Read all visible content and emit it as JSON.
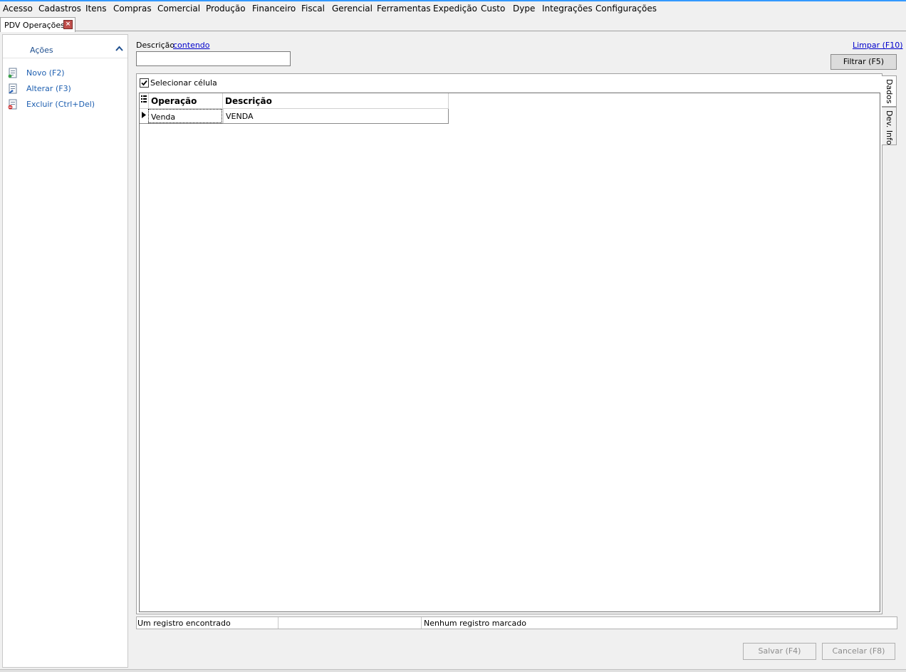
{
  "menu": [
    "Acesso",
    "Cadastros",
    "Itens",
    "Compras",
    "Comercial",
    "Produção",
    "Financeiro",
    "Fiscal",
    "Gerencial",
    "Ferramentas",
    "Expedição",
    "Custo",
    "Dype",
    "Integrações",
    "Configurações"
  ],
  "doc_tab": {
    "label": "PDV Operações",
    "close": "×"
  },
  "actions": {
    "title": "Ações",
    "items": [
      {
        "label": "Novo (F2)"
      },
      {
        "label": "Alterar (F3)"
      },
      {
        "label": "Excluir (Ctrl+Del)"
      }
    ]
  },
  "filter": {
    "field_label": "Descrição",
    "mode": "contendo",
    "value": "",
    "clear_label": "Limpar (F10)",
    "filter_button": "Filtrar (F5)"
  },
  "grid": {
    "select_cell_label": "Selecionar célula",
    "select_cell_checked": true,
    "columns": [
      "Operação",
      "Descrição"
    ],
    "rows": [
      {
        "operacao": "Venda",
        "descricao": "VENDA"
      }
    ]
  },
  "side_tabs": [
    "Dados",
    "Dev. Info"
  ],
  "status": {
    "found": "Um registro encontrado",
    "middle": "",
    "marked": "Nenhum registro marcado"
  },
  "buttons": {
    "save": "Salvar (F4)",
    "cancel": "Cancelar (F8)"
  }
}
